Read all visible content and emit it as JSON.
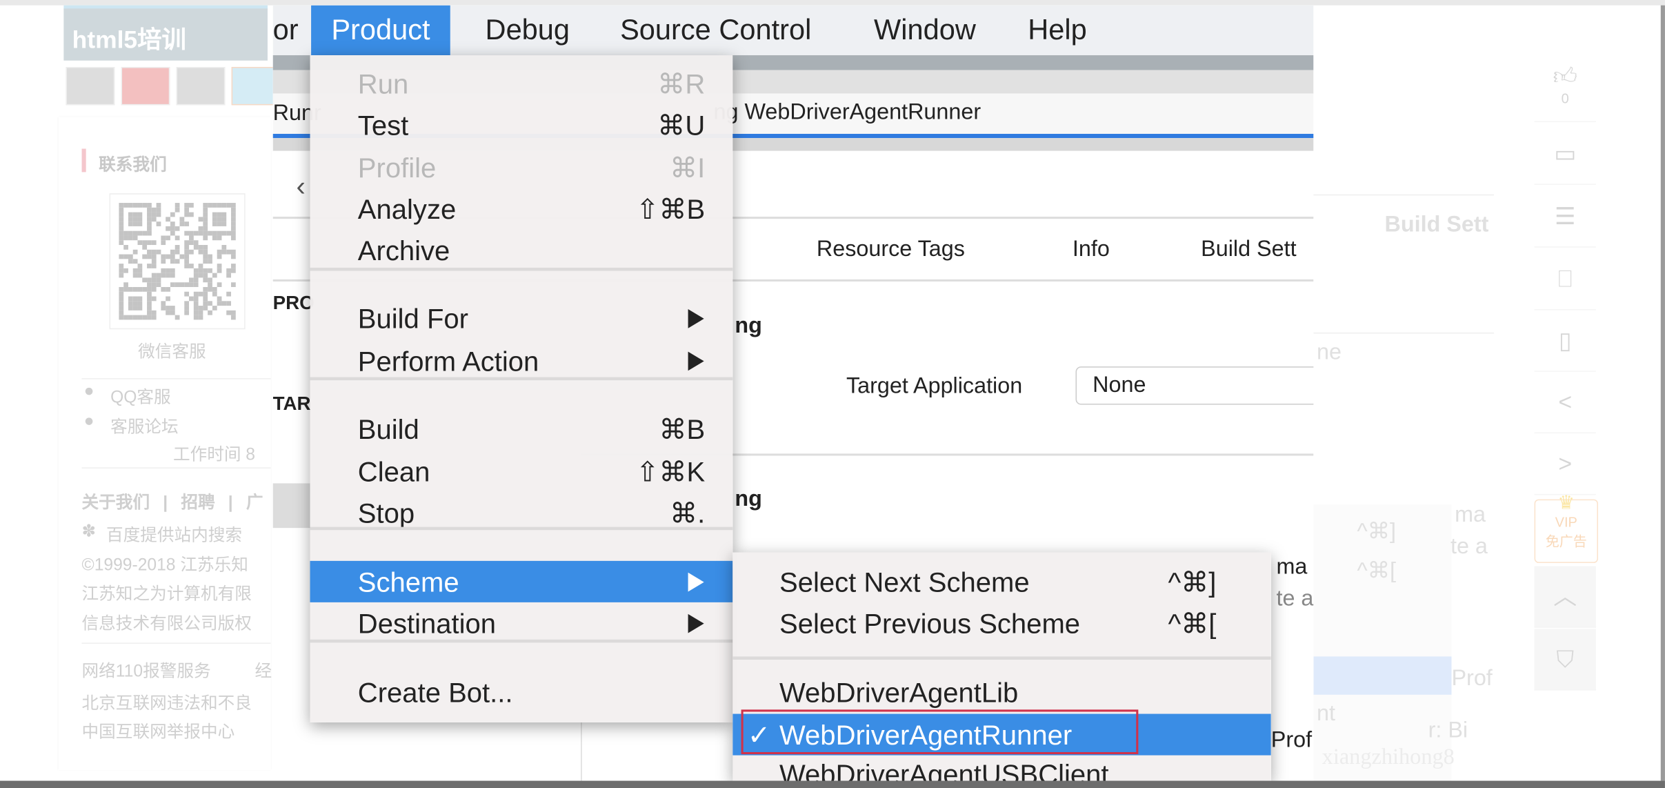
{
  "web_sidebar": {
    "banner_title": "html5培训",
    "contact_heading": "联系我们",
    "wechat_label": "微信客服",
    "qq_label": "QQ客服",
    "forum_label": "客服论坛",
    "work_hours": "工作时间 8",
    "footer_links": [
      "关于我们",
      "|",
      "招聘",
      "|",
      "广"
    ],
    "footer_lines": [
      "百度提供站内搜索",
      "©1999-2018 江苏乐知",
      "江苏知之为计算机有限",
      "信息技术有限公司版权"
    ],
    "report_lines": [
      "网络110报警服务",
      "北京互联网违法和不良",
      "中国互联网举报中心"
    ],
    "report_right": "经"
  },
  "menubar": {
    "items": [
      "or",
      "Product",
      "Debug",
      "Source Control",
      "Window",
      "Help"
    ],
    "active": "Product"
  },
  "xcode": {
    "tab_left": "Runr",
    "window_title": "ng WebDriverAgentRunner",
    "tabs": [
      "Resource Tags",
      "Info",
      "Build Sett"
    ],
    "sidebar_labels": [
      "PRO",
      "TAR"
    ],
    "section_1": "ng",
    "section_2": "ng",
    "target_app_label": "Target Application",
    "target_app_value": "None",
    "right_fragments": [
      "ma",
      "te a",
      "Prof"
    ]
  },
  "product_menu": {
    "items": [
      {
        "label": "Run",
        "shortcut": "⌘R",
        "disabled": true
      },
      {
        "label": "Test",
        "shortcut": "⌘U"
      },
      {
        "label": "Profile",
        "shortcut": "⌘I",
        "disabled": true
      },
      {
        "label": "Analyze",
        "shortcut": "⇧⌘B"
      },
      {
        "label": "Archive",
        "shortcut": ""
      },
      {
        "label": "Build For",
        "submenu": true
      },
      {
        "label": "Perform Action",
        "submenu": true
      },
      {
        "label": "Build",
        "shortcut": "⌘B"
      },
      {
        "label": "Clean",
        "shortcut": "⇧⌘K"
      },
      {
        "label": "Stop",
        "shortcut": "⌘."
      },
      {
        "label": "Scheme",
        "submenu": true,
        "highlighted": true
      },
      {
        "label": "Destination",
        "submenu": true
      },
      {
        "label": "Create Bot...",
        "shortcut": ""
      }
    ]
  },
  "scheme_submenu": {
    "items": [
      {
        "label": "Select Next Scheme",
        "shortcut": "^⌘]"
      },
      {
        "label": "Select Previous Scheme",
        "shortcut": "^⌘["
      },
      {
        "label": "WebDriverAgentLib"
      },
      {
        "label": "WebDriverAgentRunner",
        "checked": true,
        "highlighted": true
      },
      {
        "label": "WebDriverAgentUSBClient"
      }
    ],
    "check_mark": "✓"
  },
  "ghost_overlay": {
    "tab": "Build Sett",
    "field": "ne",
    "shortcuts": [
      "^⌘]",
      "^⌘["
    ],
    "fragments": [
      "ma",
      "te a",
      "Prof",
      "nt",
      "r: Bi"
    ],
    "watermark": "xiangzhihong8"
  },
  "right_rail": {
    "like_count": "0",
    "vip_label": "VIP",
    "vip_sub": "免广告"
  },
  "colors": {
    "highlight": "#3a8de5",
    "annotation_box": "#d0324a"
  }
}
